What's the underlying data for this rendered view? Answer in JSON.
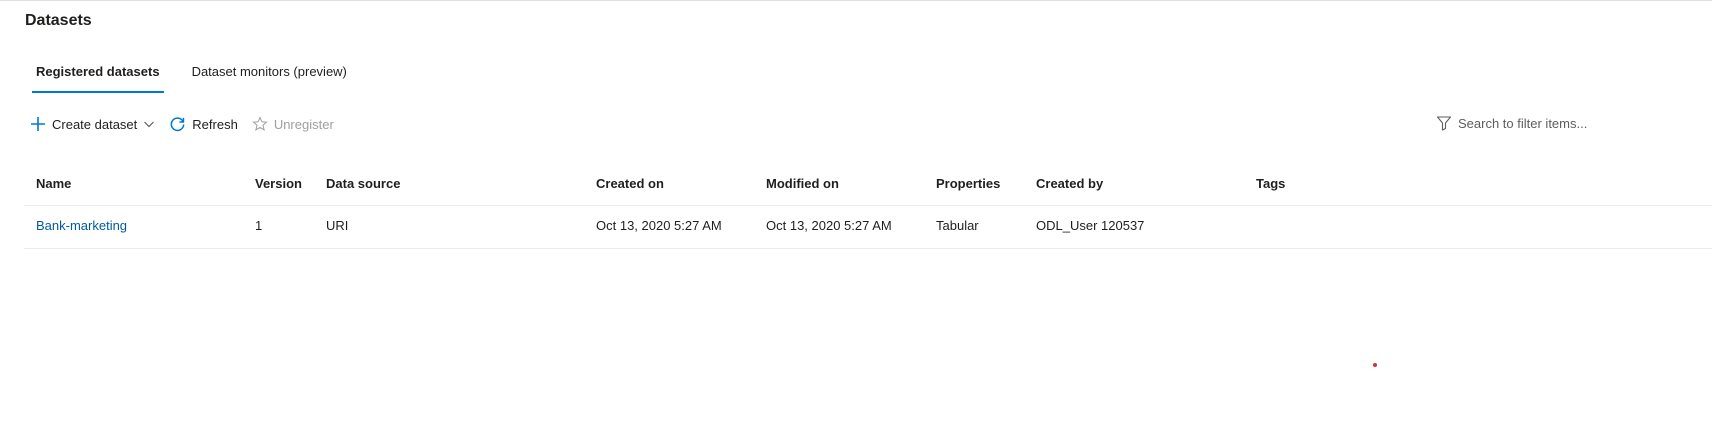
{
  "page": {
    "title": "Datasets"
  },
  "tabs": [
    {
      "label": "Registered datasets",
      "active": true
    },
    {
      "label": "Dataset monitors (preview)",
      "active": false
    }
  ],
  "toolbar": {
    "create_label": "Create dataset",
    "refresh_label": "Refresh",
    "unregister_label": "Unregister"
  },
  "search": {
    "placeholder": "Search to filter items..."
  },
  "table": {
    "headers": {
      "name": "Name",
      "version": "Version",
      "source": "Data source",
      "created": "Created on",
      "modified": "Modified on",
      "properties": "Properties",
      "created_by": "Created by",
      "tags": "Tags"
    },
    "rows": [
      {
        "name": "Bank-marketing",
        "version": "1",
        "source": "URI",
        "created": "Oct 13, 2020 5:27 AM",
        "modified": "Oct 13, 2020 5:27 AM",
        "properties": "Tabular",
        "created_by": "ODL_User 120537",
        "tags": ""
      }
    ]
  },
  "colors": {
    "accent": "#0078d4",
    "link": "#005a9e",
    "disabled": "#a19f9d",
    "cursor_dot": "#d13438"
  },
  "icons": {
    "create": "plus-icon",
    "create_dropdown": "chevron-down-icon",
    "refresh": "refresh-icon",
    "unregister": "star-icon",
    "search": "filter-icon"
  }
}
